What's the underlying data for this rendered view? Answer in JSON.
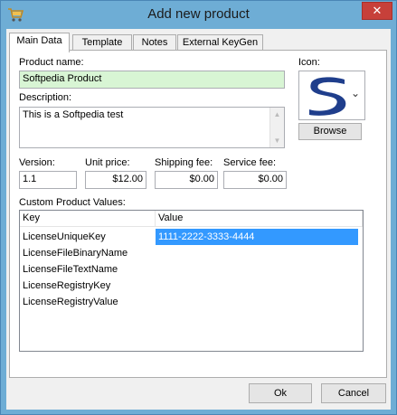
{
  "window": {
    "title": "Add new product",
    "close_glyph": "✕",
    "icon": "cart-icon"
  },
  "tabs": [
    {
      "label": "Main Data",
      "active": true
    },
    {
      "label": "Template",
      "active": false
    },
    {
      "label": "Notes",
      "active": false
    },
    {
      "label": "External KeyGen",
      "active": false
    }
  ],
  "form": {
    "product_name_label": "Product name:",
    "product_name_value": "Softpedia Product",
    "description_label": "Description:",
    "description_value": "This is a Softpedia test",
    "icon_label": "Icon:",
    "icon_image": "softpedia-s-logo",
    "browse_label": "Browse",
    "version_label": "Version:",
    "version_value": "1.1",
    "unit_price_label": "Unit price:",
    "unit_price_value": "$12.00",
    "shipping_fee_label": "Shipping fee:",
    "shipping_fee_value": "$0.00",
    "service_fee_label": "Service fee:",
    "service_fee_value": "$0.00",
    "custom_values_label": "Custom Product Values:"
  },
  "custom_values": {
    "columns": [
      "Key",
      "Value"
    ],
    "rows": [
      {
        "key": "LicenseUniqueKey",
        "value": "1111-2222-3333-4444",
        "selected": true
      },
      {
        "key": "LicenseFileBinaryName",
        "value": ""
      },
      {
        "key": "LicenseFileTextName",
        "value": ""
      },
      {
        "key": "LicenseRegistryKey",
        "value": ""
      },
      {
        "key": "LicenseRegistryValue",
        "value": ""
      }
    ]
  },
  "footer": {
    "ok_label": "Ok",
    "cancel_label": "Cancel"
  },
  "colors": {
    "title_bar": "#6eadd5",
    "close_button": "#c7403a",
    "product_name_bg": "#d8f5d4",
    "selection": "#3399ff",
    "logo_blue": "#1f3e8c"
  }
}
